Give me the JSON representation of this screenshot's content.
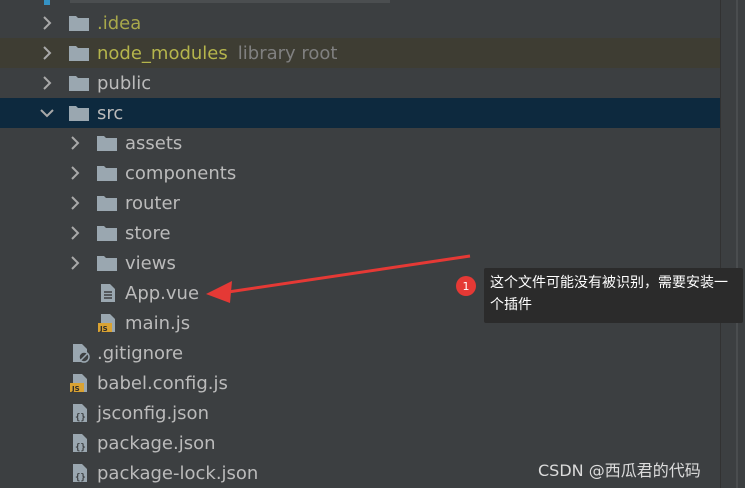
{
  "tree": [
    {
      "label": ".idea",
      "suffix": "",
      "type": "folder",
      "expanded": false,
      "style": "idea"
    },
    {
      "label": "node_modules",
      "suffix": "library root",
      "type": "folder",
      "expanded": false,
      "style": "nm"
    },
    {
      "label": "public",
      "suffix": "",
      "type": "folder",
      "expanded": false,
      "style": ""
    },
    {
      "label": "src",
      "suffix": "",
      "type": "folder",
      "expanded": true,
      "style": ""
    },
    {
      "label": "assets",
      "suffix": "",
      "type": "folder",
      "expanded": false,
      "style": ""
    },
    {
      "label": "components",
      "suffix": "",
      "type": "folder",
      "expanded": false,
      "style": ""
    },
    {
      "label": "router",
      "suffix": "",
      "type": "folder",
      "expanded": false,
      "style": ""
    },
    {
      "label": "store",
      "suffix": "",
      "type": "folder",
      "expanded": false,
      "style": ""
    },
    {
      "label": "views",
      "suffix": "",
      "type": "folder",
      "expanded": false,
      "style": ""
    },
    {
      "label": "App.vue",
      "suffix": "",
      "type": "text-file",
      "style": ""
    },
    {
      "label": "main.js",
      "suffix": "",
      "type": "js-file",
      "style": ""
    },
    {
      "label": ".gitignore",
      "suffix": "",
      "type": "ignore-file",
      "style": ""
    },
    {
      "label": "babel.config.js",
      "suffix": "",
      "type": "js-file",
      "style": ""
    },
    {
      "label": "jsconfig.json",
      "suffix": "",
      "type": "json-file",
      "style": ""
    },
    {
      "label": "package.json",
      "suffix": "",
      "type": "json-file",
      "style": ""
    },
    {
      "label": "package-lock.json",
      "suffix": "",
      "type": "json-file",
      "style": ""
    }
  ],
  "annotation": {
    "badge": "1",
    "text": "这个文件可能没有被识别，需要安装一个插件"
  },
  "watermark": "CSDN @西瓜君的代码",
  "colors": {
    "background": "#3c3f41",
    "selected_row": "#0d293e",
    "highlight_row": "#3e3d33",
    "arrow": "#e53935"
  }
}
